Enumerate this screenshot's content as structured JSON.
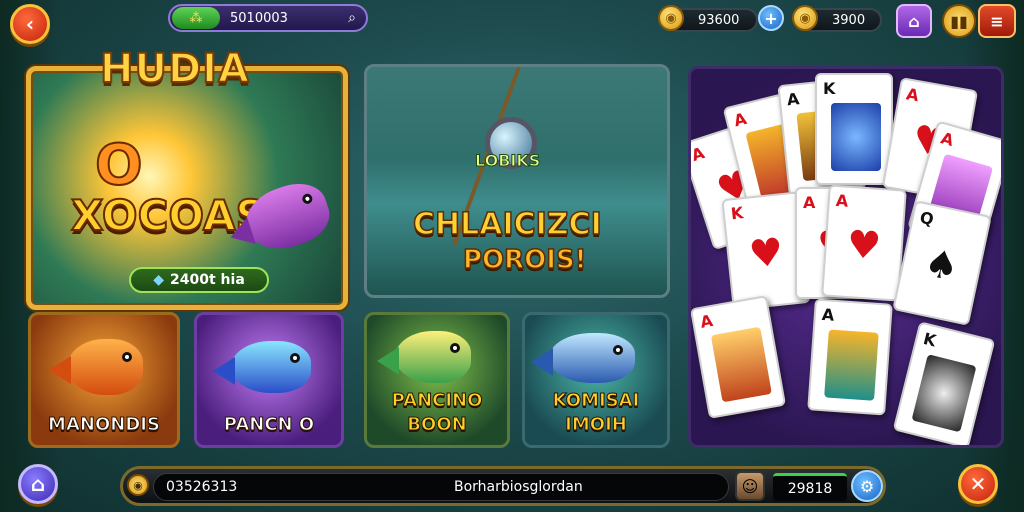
{
  "header": {
    "back_icon": "‹",
    "search_value": "5010003",
    "search_gem": "⁂",
    "search_icon": "⌕",
    "coins_primary": "93600",
    "coins_secondary": "3900",
    "shop_icon": "⌂",
    "menu_icon": "≡",
    "plus_icon": "+"
  },
  "hero": {
    "title": "HUDIA",
    "big_zero": "O",
    "subtitle": "XOCOAS",
    "badge_value": "2400t hia",
    "badge_gem": "◆"
  },
  "lake": {
    "label": "LOBIKS",
    "title": "CHLAICIZCI",
    "subtitle": "POROIS!"
  },
  "tiles": [
    {
      "label": "MANONDIS"
    },
    {
      "label": "PANCN O"
    },
    {
      "label_top": "PANCINO",
      "label": "BOON"
    },
    {
      "label_top": "KOMISAI",
      "label": "IMOIH"
    }
  ],
  "cards": {
    "ranks": [
      "A",
      "A",
      "A",
      "K",
      "A",
      "A",
      "K",
      "A",
      "A",
      "Q",
      "A",
      "A",
      "K"
    ],
    "suit_heart": "♥",
    "suit_spade": "♠",
    "suit_diamond": "♦"
  },
  "bottom": {
    "home_icon": "⌂",
    "chat_left_value": "03526313",
    "chat_center_text": "Borharbiosglordan",
    "score": "29818",
    "settings_icon": "⚙",
    "close_icon": "✕",
    "avatar_icon": "☺"
  },
  "colors": {
    "accent_gold": "#e7b23a",
    "panel_purple": "#5a2e96",
    "button_red": "#c4210c",
    "button_blue": "#1b63c8"
  }
}
